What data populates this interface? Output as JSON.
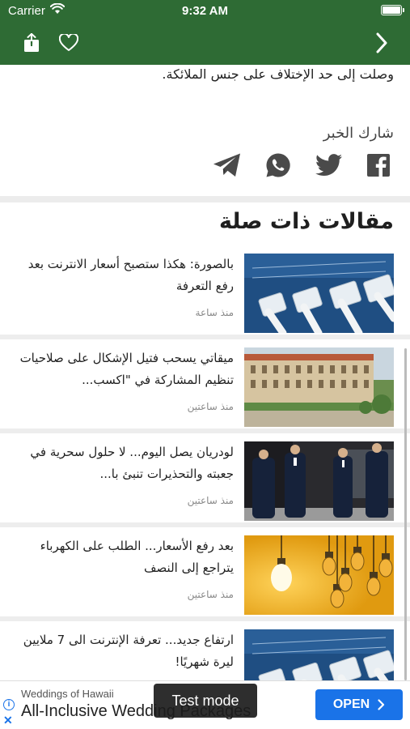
{
  "status_bar": {
    "carrier": "Carrier",
    "time": "9:32 AM"
  },
  "header": {
    "brand_color": "#2e6b34",
    "icons": [
      "share-icon",
      "heart-icon",
      "chevron-right-icon"
    ]
  },
  "article": {
    "tail_text": "وصلت إلى حد الإختلاف على جنس الملائكة.",
    "share_label": "شارك الخبر",
    "share_icons": [
      "facebook-icon",
      "twitter-icon",
      "whatsapp-icon",
      "telegram-icon"
    ]
  },
  "related": {
    "title": "مقالات ذات صلة",
    "items": [
      {
        "title": "بالصورة: هكذا ستصبح أسعار الانترنت بعد رفع التعرفة",
        "time": "منذ ساعة",
        "image": "network-cables"
      },
      {
        "title": "ميقاتي يسحب فتيل الإشكال على صلاحيات تنظيم المشاركة في \"اكسب...",
        "time": "منذ ساعتين",
        "image": "government-palace"
      },
      {
        "title": "لودريان يصل اليوم... لا حلول سحرية في جعبته والتحذيرات تنبئ با...",
        "time": "منذ ساعتين",
        "image": "officials-walking"
      },
      {
        "title": "بعد رفع الأسعار... الطلب على الكهرباء يتراجع إلى النصف",
        "time": "منذ ساعتين",
        "image": "light-bulbs"
      },
      {
        "title": "ارتفاع جديد... تعرفة الإنترنت الى 7 ملايين ليرة شهريًا!",
        "time": "",
        "image": "network-cables"
      }
    ]
  },
  "ad": {
    "subtitle": "Weddings of Hawaii",
    "main_text": "All-Inclusive Wedding Packages",
    "open_label": "OPEN",
    "test_mode_label": "Test mode",
    "accent": "#1a73e8"
  }
}
